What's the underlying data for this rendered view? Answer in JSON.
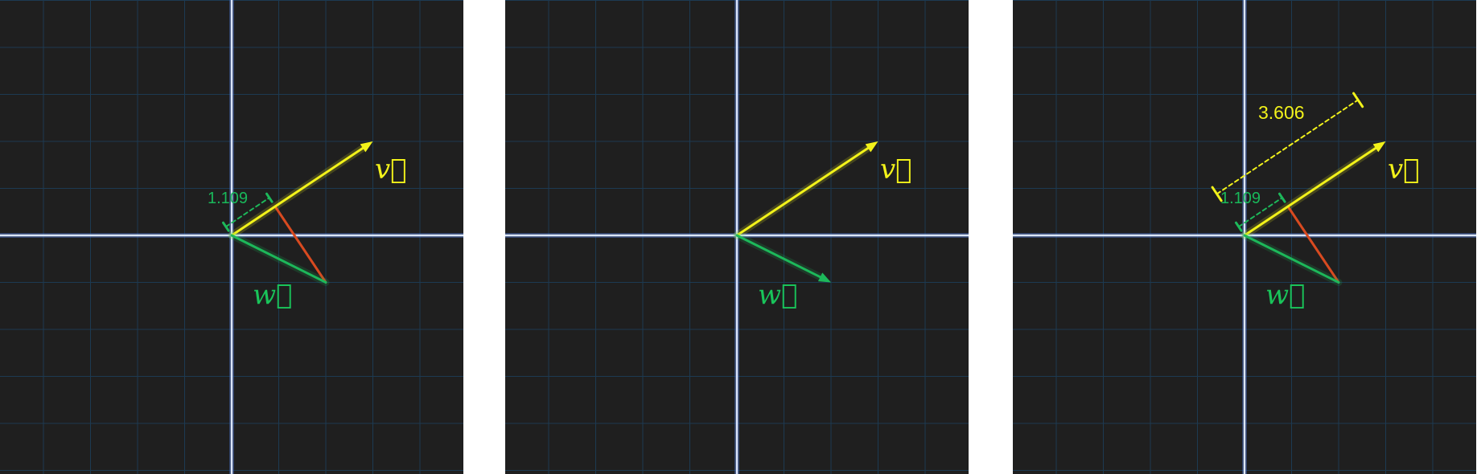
{
  "colors": {
    "background": "#1f1f1f",
    "grid": "#1c3a52",
    "axis": "#dbe6ff",
    "vector_v": "#f2f21a",
    "vector_w": "#1db85a",
    "difference": "#d84a20"
  },
  "vectors": {
    "v": {
      "name": "v",
      "label": "v⃗",
      "x": 3,
      "y": 2
    },
    "w": {
      "name": "w",
      "label": "w⃗",
      "x": 2,
      "y": -1
    }
  },
  "panels": [
    {
      "id": "projection-of-v-onto-w",
      "label_v": "v⃗",
      "label_w": "w⃗",
      "measure_green": "1.109"
    },
    {
      "id": "vectors-only",
      "label_v": "v⃗",
      "label_w": "w⃗"
    },
    {
      "id": "projection-with-length",
      "label_v": "v⃗",
      "label_w": "w⃗",
      "measure_green": "1.109",
      "measure_yellow": "3.606"
    }
  ]
}
